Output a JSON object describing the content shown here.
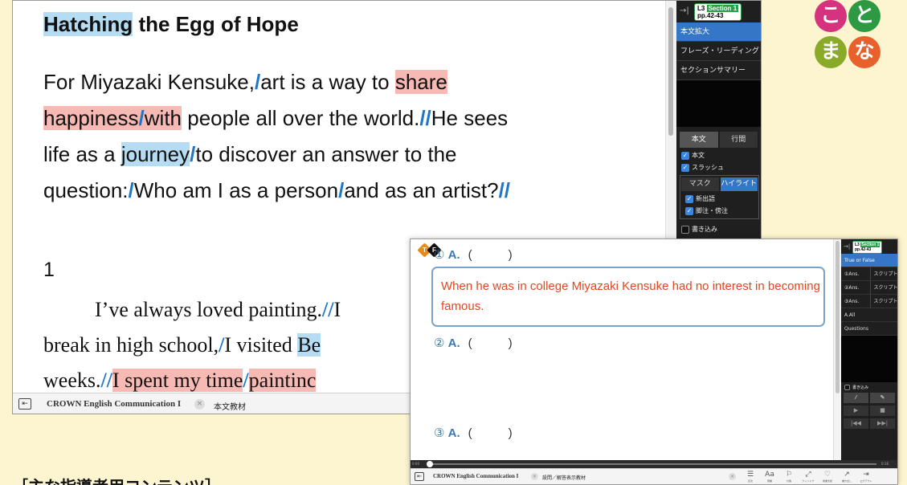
{
  "reader": {
    "title_highlight": "Hatching",
    "title_rest": " the Egg of Hope",
    "line1_a": "For Miyazaki Kensuke,",
    "line1_b": "art is a way to ",
    "line1_c": "share",
    "line2_a": "happiness",
    "line2_b": "with",
    "line2_c": " people all over the world.",
    "line2_d": "He sees",
    "line3_a": "life as a ",
    "line3_b": "journey",
    "line3_c": "to discover an answer to the",
    "line4_a": "question:",
    "line4_b": "Who am I as a person",
    "line4_c": "and as an artist?",
    "para_num": "1",
    "s_line1": "I’ve always loved painting.",
    "s_line1_tail": "I",
    "s_line2_a": "break in high school,",
    "s_line2_b": "I visited ",
    "s_line2_c": "Be",
    "s_line3_a": "weeks.",
    "s_line3_b": "I spent my time",
    "s_line3_c": "paintinc",
    "slash_single": "/",
    "slash_double": "//"
  },
  "right_panel": {
    "badge_level": "L3",
    "badge_section": "Section 1",
    "badge_pages": "pp.42-43",
    "collapse_arrow": "→|",
    "items": [
      {
        "label": "本文拡大"
      },
      {
        "label": "フレーズ・リーディング"
      },
      {
        "label": "セクションサマリー"
      }
    ],
    "tab_honbun": "本文",
    "tab_gyokan": "行間",
    "chk_honbun": "本文",
    "chk_slash": "スラッシュ",
    "tab_mask": "マスク",
    "tab_highlight": "ハイライト",
    "chk_shinshutsu": "新出語",
    "chk_chuu": "脚注・傍注",
    "chk_kakikomi": "書き込み"
  },
  "bottom_bar": {
    "book": "CROWN English Communication I",
    "close": "×",
    "tab": "本文教材"
  },
  "logo": {
    "chars": [
      "こ",
      "と",
      "ま",
      "な"
    ],
    "colors": [
      "#d6337f",
      "#2d9a43",
      "#8aaa2a",
      "#e8602c"
    ]
  },
  "quiz": {
    "tf_t": "T",
    "tf_f": "F",
    "q1_num": "①",
    "q2_num": "②",
    "q3_num": "③",
    "answer_label": "A.",
    "paren": "(　　　)",
    "statement": "When he was in college Miyazaki Kensuke had no interest in becoming famous.",
    "side_badge_level": "L3",
    "side_badge_section": "Section 1",
    "side_badge_pages": "pp.42-43",
    "side_active": "True or False",
    "side_rows": [
      {
        "left": "①Ans.",
        "right": "スクリプト"
      },
      {
        "left": "②Ans.",
        "right": "スクリプト"
      },
      {
        "left": "③Ans.",
        "right": "スクリプト"
      }
    ],
    "side_all": "A.All",
    "side_questions": "Questions",
    "side_kakikomi": "書き込み",
    "progress_start": "0:00",
    "progress_end": "0:16",
    "progress_fraction": 0.0,
    "bar_book": "CROWN English Communication I",
    "bar_tab": "設問／解答表示教材",
    "tools": [
      {
        "icon": "☰",
        "label": "目次"
      },
      {
        "icon": "Aa",
        "label": "辞書"
      },
      {
        "icon": "⚐",
        "label": "付箋"
      },
      {
        "icon": "⤢",
        "label": "ウィンドウ"
      },
      {
        "icon": "♡",
        "label": "授業支援"
      },
      {
        "icon": "↗",
        "label": "書き出し"
      },
      {
        "icon": "⇥",
        "label": "ログアウト"
      }
    ]
  },
  "footer": {
    "text": "［主な指導者用コンテンツ］"
  }
}
